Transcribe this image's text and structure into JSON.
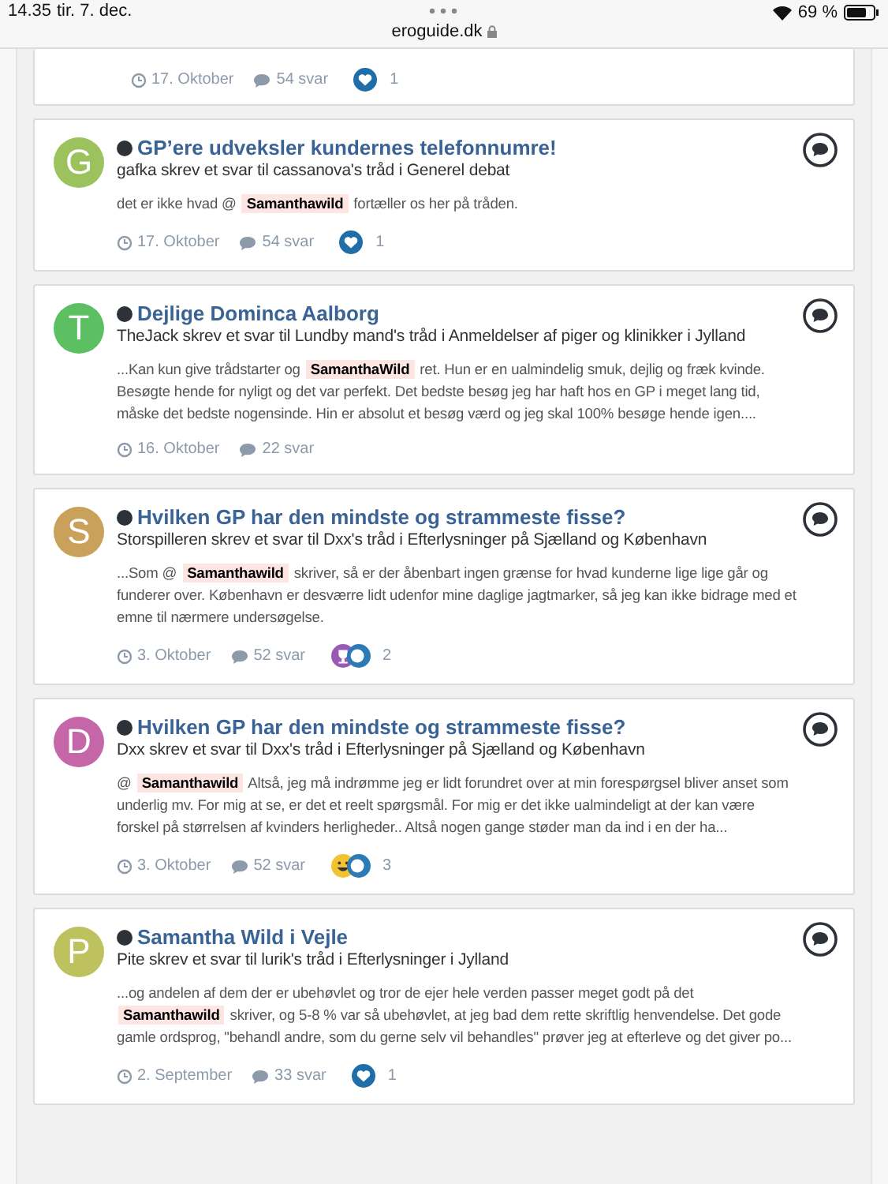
{
  "status_bar": {
    "time": "14.35",
    "date": "tir. 7. dec.",
    "url": "eroguide.dk",
    "battery": "69 %"
  },
  "previous_post": {
    "date": "17. Oktober",
    "replies": "54 svar",
    "reactions": [
      {
        "kind": "like"
      }
    ],
    "reaction_count": "1"
  },
  "posts": [
    {
      "avatar_letter": "G",
      "color": "#9bc25c",
      "title": "GP’ere udveksler kundernes telefonnumre!",
      "byline": "gafka skrev et svar til cassanova's tråd i Generel debat",
      "body": {
        "before": "det er ikke hvad @",
        "mention": "Samanthawild",
        "after": "fortæller os her på tråden."
      },
      "date": "17. Oktober",
      "replies": "54 svar",
      "reactions": [
        {
          "kind": "like"
        }
      ],
      "reaction_count": "1"
    },
    {
      "avatar_letter": "T",
      "color": "#5cbf62",
      "title": "Dejlige Dominca Aalborg",
      "byline": "TheJack skrev et svar til Lundby mand's tråd i Anmeldelser af piger og klinikker i Jylland",
      "body": {
        "before": "...Kan kun give trådstarter og",
        "mention": "SamanthaWild",
        "after": "ret. Hun er en ualmindelig smuk, dejlig og fræk kvinde. Besøgte hende for nyligt og det var perfekt. Det bedste besøg jeg har haft hos en GP i meget lang tid, måske det bedste nogensinde. Hin er absolut et besøg værd og jeg skal 100% besøge hende igen...."
      },
      "date": "16. Oktober",
      "replies": "22 svar"
    },
    {
      "avatar_letter": "S",
      "color": "#c9a15a",
      "title": "Hvilken GP har den mindste og strammeste fisse?",
      "byline": "Storspilleren skrev et svar til Dxx's tråd i Efterlysninger på Sjælland og København",
      "body": {
        "before": "...Som @",
        "mention": "Samanthawild",
        "after": "skriver, så er der åbenbart ingen grænse for hvad kunderne lige lige går og funderer over. København er desværre lidt udenfor mine daglige jagtmarker, så jeg kan ikke bidrage med et emne til nærmere undersøgelse."
      },
      "date": "3. Oktober",
      "replies": "52 svar",
      "reactions": [
        {
          "kind": "trophy"
        },
        {
          "kind": "thanks"
        }
      ],
      "reaction_count": "2"
    },
    {
      "avatar_letter": "D",
      "color": "#c466a8",
      "title": "Hvilken GP har den mindste og strammeste fisse?",
      "byline": "Dxx skrev et svar til Dxx's tråd i Efterlysninger på Sjælland og København",
      "body": {
        "before": "@",
        "mention": "Samanthawild",
        "after": "Altså, jeg må indrømme jeg er lidt forundret over at min forespørgsel bliver anset som underlig mv. For mig at se, er det et reelt spørgsmål. For mig er det ikke ualmindeligt at der kan være forskel på størrelsen af kvinders herligheder.. Altså nogen gange støder man da ind i en der ha..."
      },
      "date": "3. Oktober",
      "replies": "52 svar",
      "reactions": [
        {
          "kind": "laugh"
        },
        {
          "kind": "thanks"
        }
      ],
      "reaction_count": "3"
    },
    {
      "avatar_letter": "P",
      "color": "#bdc25e",
      "title": "Samantha Wild i Vejle",
      "byline": "Pite skrev et svar til lurik's tråd i Efterlysninger i Jylland",
      "body": {
        "before": "...og andelen af dem der er ubehøvlet og tror de ejer hele verden passer meget godt på det",
        "mention": "Samanthawild",
        "after": "skriver, og 5-8 % var så ubehøvlet, at jeg bad dem rette skriftlig henvendelse. Det gode gamle ordsprog, \"behandl andre, som du gerne selv vil behandles\" prøver jeg at efterleve og det giver po..."
      },
      "date": "2. September",
      "replies": "33 svar",
      "reactions": [
        {
          "kind": "like"
        }
      ],
      "reaction_count": "1"
    }
  ]
}
